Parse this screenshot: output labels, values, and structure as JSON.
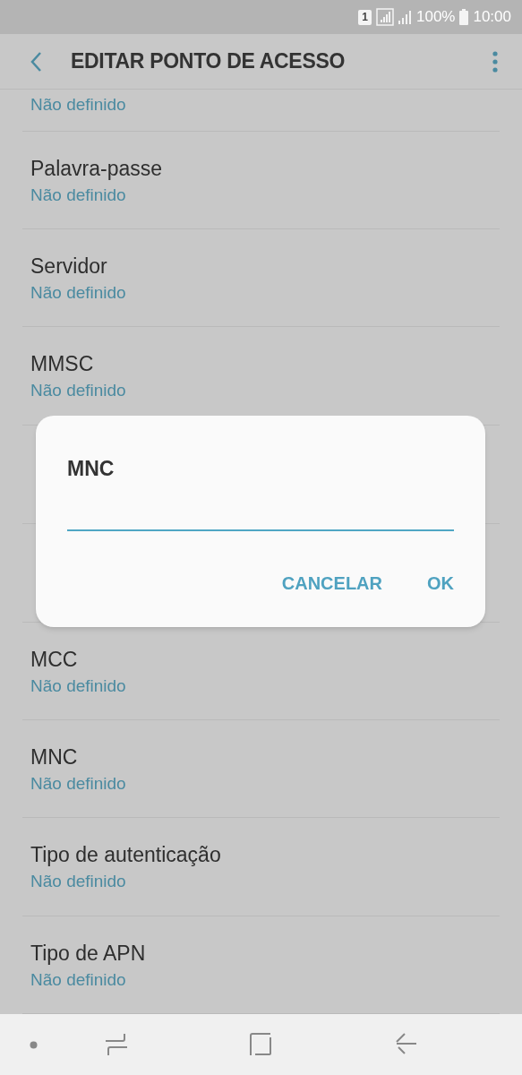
{
  "status_bar": {
    "sim_slot": "1",
    "battery": "100%",
    "time": "10:00"
  },
  "app_bar": {
    "title": "EDITAR PONTO DE ACESSO"
  },
  "settings": [
    {
      "value": "Não definido"
    },
    {
      "title": "Palavra-passe",
      "value": "Não definido"
    },
    {
      "title": "Servidor",
      "value": "Não definido"
    },
    {
      "title": "MMSC",
      "value": "Não definido"
    },
    {
      "kind": "covered"
    },
    {
      "kind": "covered"
    },
    {
      "title": "MCC",
      "value": "Não definido"
    },
    {
      "title": "MNC",
      "value": "Não definido"
    },
    {
      "title": "Tipo de autenticação",
      "value": "Não definido"
    },
    {
      "title": "Tipo de APN",
      "value": "Não definido"
    }
  ],
  "dialog": {
    "title": "MNC",
    "buttons": [
      "CANCELAR",
      "OK"
    ]
  }
}
